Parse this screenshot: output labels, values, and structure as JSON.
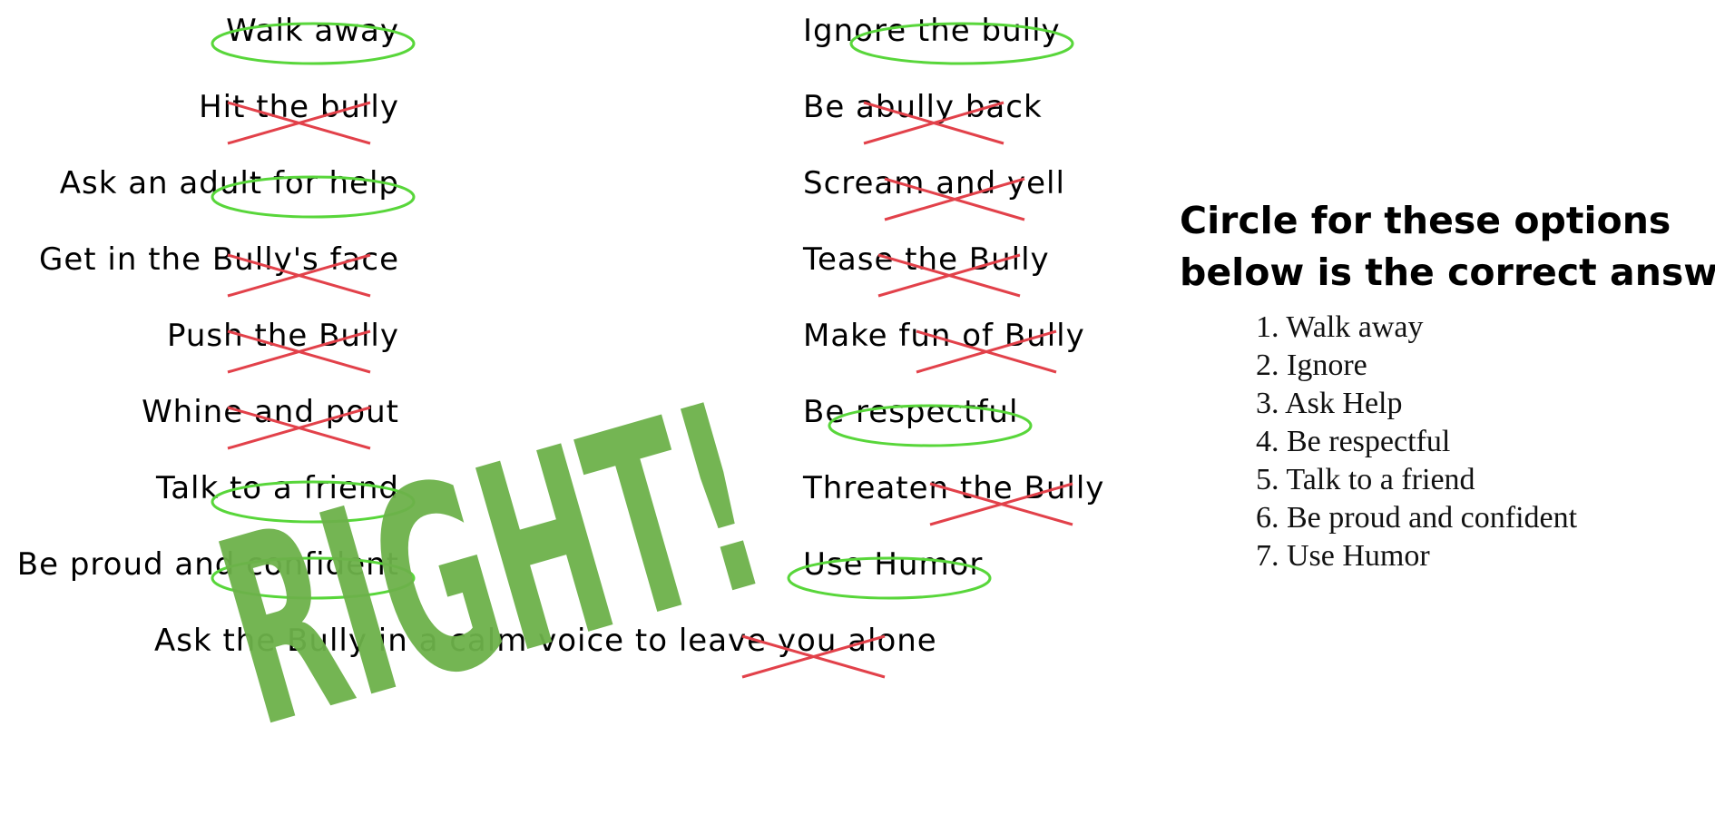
{
  "colors": {
    "circle": "#58d63a",
    "cross": "#e2414a",
    "right_stamp": "#6db24a"
  },
  "left_options": [
    {
      "label": "Walk away",
      "mark": "circle"
    },
    {
      "label": "Hit the bully",
      "mark": "cross"
    },
    {
      "label": "Ask an adult for help",
      "mark": "circle"
    },
    {
      "label": "Get in the Bully's face",
      "mark": "cross"
    },
    {
      "label": "Push the Bully",
      "mark": "cross"
    },
    {
      "label": "Whine and pout",
      "mark": "cross"
    },
    {
      "label": "Talk to a friend",
      "mark": "circle"
    },
    {
      "label": "Be proud and confident",
      "mark": "circle"
    }
  ],
  "right_options": [
    {
      "label": "Ignore the bully",
      "mark": "circle"
    },
    {
      "label": "Be abully back",
      "mark": "cross"
    },
    {
      "label": "Scream and yell",
      "mark": "cross"
    },
    {
      "label": "Tease the Bully",
      "mark": "cross"
    },
    {
      "label": "Make fun of Bully",
      "mark": "cross"
    },
    {
      "label": "Be respectful",
      "mark": "circle"
    },
    {
      "label": "Threaten the Bully",
      "mark": "cross"
    },
    {
      "label": "Use Humor",
      "mark": "circle"
    }
  ],
  "bottom_option": {
    "label": "Ask the Bully in a calm voice to leave you alone",
    "mark": "cross"
  },
  "stamp": "RIGHT!",
  "instructions": {
    "title_line1": "Circle for these options",
    "title_line2": "below is the correct answer",
    "answers": [
      "1. Walk away",
      "2. Ignore",
      "3. Ask Help",
      "4. Be respectful",
      "5. Talk to a friend",
      "6. Be proud and confident",
      "7. Use Humor"
    ]
  }
}
